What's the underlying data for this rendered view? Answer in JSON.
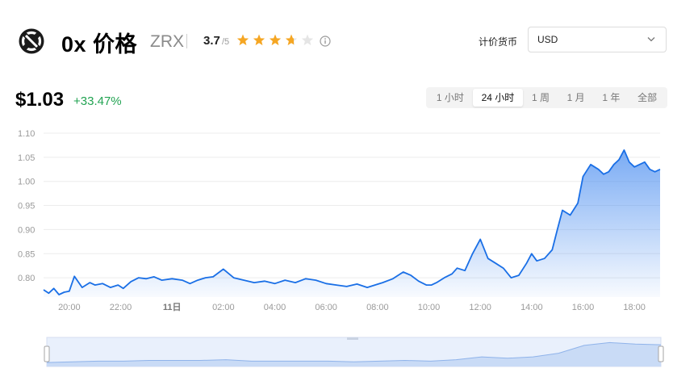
{
  "header": {
    "coin_name": "0x 价格",
    "symbol": "ZRX",
    "rating": "3.7",
    "rating_max": "/5",
    "rating_value": 3.7,
    "logo_icon": "0x-logo-icon",
    "info_icon": "info-circle-icon"
  },
  "currency": {
    "label": "计价货币",
    "selected": "USD"
  },
  "summary": {
    "price": "$1.03",
    "change": "+33.47%"
  },
  "time_ranges": [
    {
      "label": "1 小时",
      "active": false
    },
    {
      "label": "24 小时",
      "active": true
    },
    {
      "label": "1 周",
      "active": false
    },
    {
      "label": "1 月",
      "active": false
    },
    {
      "label": "1 年",
      "active": false
    },
    {
      "label": "全部",
      "active": false
    }
  ],
  "colors": {
    "line": "#1a6fe6",
    "area_top": "#4d8ff0",
    "positive": "#22a352",
    "star": "#f5a623",
    "star_empty": "#e5e5e5"
  },
  "chart_data": {
    "type": "area",
    "ylim": [
      0.76,
      1.1
    ],
    "yticks": [
      0.8,
      0.85,
      0.9,
      0.95,
      1.0,
      1.05,
      1.1
    ],
    "ytick_labels": [
      "0.80",
      "0.85",
      "0.90",
      "0.95",
      "1.00",
      "1.05",
      "1.10"
    ],
    "xlim": [
      19.0,
      43.0
    ],
    "xticks": [
      20,
      22,
      24,
      26,
      28,
      30,
      32,
      34,
      36,
      38,
      40,
      42
    ],
    "xtick_labels": [
      "20:00",
      "22:00",
      "11日",
      "02:00",
      "04:00",
      "06:00",
      "08:00",
      "10:00",
      "12:00",
      "14:00",
      "16:00",
      "18:00"
    ],
    "grid": true,
    "series": [
      {
        "x": [
          19.0,
          19.2,
          19.4,
          19.6,
          19.8,
          20.0,
          20.2,
          20.5,
          20.8,
          21.0,
          21.3,
          21.6,
          21.9,
          22.1,
          22.4,
          22.7,
          23.0,
          23.3,
          23.6,
          24.0,
          24.4,
          24.7,
          25.0,
          25.3,
          25.6,
          26.0,
          26.4,
          26.8,
          27.2,
          27.6,
          28.0,
          28.4,
          28.8,
          29.2,
          29.6,
          30.0,
          30.4,
          30.8,
          31.2,
          31.6,
          31.9,
          32.2,
          32.6,
          33.0,
          33.3,
          33.6,
          33.9,
          34.1,
          34.3,
          34.6,
          34.9,
          35.1,
          35.4,
          35.7,
          36.0,
          36.3,
          36.6,
          36.9,
          37.2,
          37.5,
          37.8,
          38.0,
          38.2,
          38.5,
          38.8,
          39.0,
          39.2,
          39.5,
          39.8,
          40.0,
          40.3,
          40.6,
          40.8,
          41.0,
          41.2,
          41.4,
          41.6,
          41.8,
          42.0,
          42.2,
          42.4,
          42.6,
          42.8,
          43.0
        ],
        "y": [
          0.775,
          0.768,
          0.778,
          0.765,
          0.77,
          0.772,
          0.803,
          0.78,
          0.79,
          0.785,
          0.788,
          0.78,
          0.785,
          0.778,
          0.792,
          0.8,
          0.798,
          0.802,
          0.795,
          0.798,
          0.795,
          0.788,
          0.795,
          0.8,
          0.802,
          0.818,
          0.8,
          0.795,
          0.79,
          0.793,
          0.788,
          0.795,
          0.79,
          0.798,
          0.795,
          0.788,
          0.785,
          0.782,
          0.787,
          0.78,
          0.785,
          0.79,
          0.798,
          0.812,
          0.805,
          0.793,
          0.785,
          0.785,
          0.79,
          0.8,
          0.808,
          0.82,
          0.815,
          0.85,
          0.88,
          0.84,
          0.83,
          0.82,
          0.8,
          0.805,
          0.83,
          0.85,
          0.835,
          0.84,
          0.858,
          0.9,
          0.94,
          0.93,
          0.955,
          1.01,
          1.035,
          1.025,
          1.015,
          1.02,
          1.035,
          1.045,
          1.065,
          1.04,
          1.03,
          1.035,
          1.04,
          1.025,
          1.02,
          1.025
        ]
      }
    ]
  },
  "navigator": {
    "x": [
      19.0,
      20.0,
      21.0,
      22.0,
      23.0,
      24.0,
      25.0,
      26.0,
      27.0,
      28.0,
      29.0,
      30.0,
      31.0,
      32.0,
      33.0,
      34.0,
      35.0,
      36.0,
      37.0,
      38.0,
      39.0,
      40.0,
      41.0,
      42.0,
      43.0
    ],
    "y": [
      0.77,
      0.78,
      0.79,
      0.79,
      0.8,
      0.8,
      0.8,
      0.81,
      0.79,
      0.79,
      0.79,
      0.79,
      0.78,
      0.79,
      0.8,
      0.79,
      0.81,
      0.85,
      0.83,
      0.85,
      0.9,
      1.01,
      1.05,
      1.03,
      1.02
    ]
  }
}
